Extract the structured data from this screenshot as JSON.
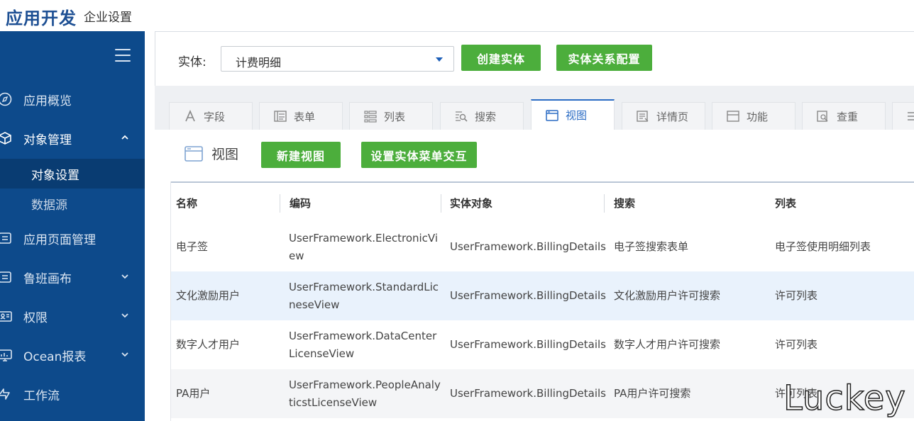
{
  "header": {
    "title": "应用开发",
    "subtitle": "企业设置"
  },
  "sidebar": {
    "items": [
      {
        "label": "应用概览",
        "icon": "compass-icon"
      },
      {
        "label": "对象管理",
        "icon": "cube-icon",
        "expanded": true,
        "children": [
          {
            "label": "对象设置",
            "active": true
          },
          {
            "label": "数据源"
          }
        ]
      },
      {
        "label": "应用页面管理",
        "icon": "page-icon"
      },
      {
        "label": "鲁班画布",
        "icon": "canvas-icon",
        "has_children": true
      },
      {
        "label": "权限",
        "icon": "id-card-icon",
        "has_children": true
      },
      {
        "label": "Ocean报表",
        "icon": "monitor-icon",
        "has_children": true
      },
      {
        "label": "工作流",
        "icon": "flow-icon"
      }
    ]
  },
  "entity_bar": {
    "label": "实体:",
    "selected": "计费明细",
    "create_btn": "创建实体",
    "relation_btn": "实体关系配置"
  },
  "tabs": [
    {
      "label": "字段",
      "icon": "font-icon"
    },
    {
      "label": "表单",
      "icon": "form-icon"
    },
    {
      "label": "列表",
      "icon": "list-icon"
    },
    {
      "label": "搜索",
      "icon": "search-list-icon"
    },
    {
      "label": "视图",
      "icon": "window-icon",
      "active": true
    },
    {
      "label": "详情页",
      "icon": "detail-icon"
    },
    {
      "label": "功能",
      "icon": "function-icon"
    },
    {
      "label": "查重",
      "icon": "duplicate-check-icon"
    }
  ],
  "view_panel": {
    "title": "视图",
    "new_btn": "新建视图",
    "menu_btn": "设置实体菜单交互"
  },
  "table": {
    "columns": [
      "名称",
      "编码",
      "实体对象",
      "搜索",
      "列表"
    ],
    "rows": [
      [
        "电子签",
        "UserFramework.ElectronicView",
        "UserFramework.BillingDetails",
        "电子签搜索表单",
        "电子签使用明细列表"
      ],
      [
        "文化激励用户",
        "UserFramework.StandardLicneseView",
        "UserFramework.BillingDetails",
        "文化激励用户许可搜索",
        "许可列表"
      ],
      [
        "数字人才用户",
        "UserFramework.DataCenterLicenseView",
        "UserFramework.BillingDetails",
        "数字人才用户许可搜索",
        "许可列表"
      ],
      [
        "PA用户",
        "UserFramework.PeopleAnalyticstLicenseView",
        "UserFramework.BillingDetails",
        "PA用户许可搜索",
        "许可列表"
      ]
    ]
  },
  "watermark": "Luckey",
  "colors": {
    "sidebar": "#0d4a8b",
    "accent": "#2b6cc4",
    "button": "#4cae3c"
  }
}
